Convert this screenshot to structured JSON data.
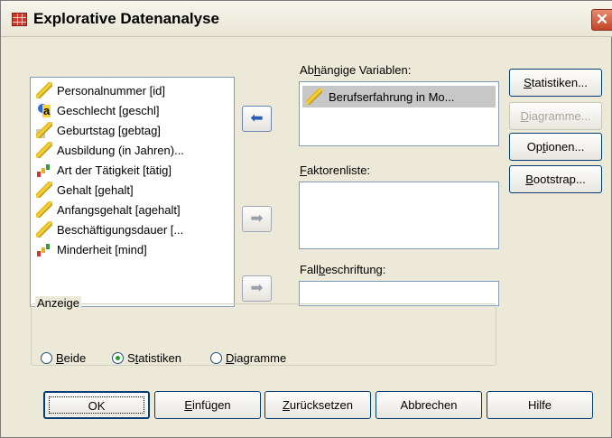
{
  "window": {
    "title": "Explorative Datenanalyse",
    "close_symbol": "✕"
  },
  "source_list": {
    "items": [
      {
        "label": "Personalnummer [id]",
        "icon": "scale-ruler-icon"
      },
      {
        "label": "Geschlecht [geschl]",
        "icon": "nominal-icon"
      },
      {
        "label": "Geburtstag [gebtag]",
        "icon": "date-icon"
      },
      {
        "label": "Ausbildung (in Jahren)...",
        "icon": "scale-ruler-icon"
      },
      {
        "label": "Art der Tätigkeit [tätig]",
        "icon": "ordinal-icon"
      },
      {
        "label": "Gehalt [gehalt]",
        "icon": "scale-ruler-icon"
      },
      {
        "label": "Anfangsgehalt [agehalt]",
        "icon": "scale-ruler-icon"
      },
      {
        "label": "Beschäftigungsdauer [...",
        "icon": "scale-ruler-icon"
      },
      {
        "label": "Minderheit [mind]",
        "icon": "ordinal-icon"
      }
    ]
  },
  "dependent": {
    "label_pre": "Ab",
    "label_u": "h",
    "label_post": "ängige Variablen:",
    "items": [
      {
        "label": "Berufserfahrung in Mo...",
        "icon": "scale-ruler-icon"
      }
    ]
  },
  "factors": {
    "label_u": "F",
    "label_post": "aktorenliste:"
  },
  "case_label": {
    "label_pre": "Fall",
    "label_u": "b",
    "label_post": "eschriftung:"
  },
  "side_buttons": {
    "statistics": {
      "pre": "",
      "u": "S",
      "post": "tatistiken..."
    },
    "plots": {
      "pre": "",
      "u": "D",
      "post": "iagramme..."
    },
    "options": {
      "pre": "Op",
      "u": "t",
      "post": "ionen..."
    },
    "bootstrap": {
      "pre": "",
      "u": "B",
      "post": "ootstrap..."
    }
  },
  "display": {
    "legend": "Anzeige",
    "options": [
      {
        "pre": "",
        "u": "B",
        "post": "eide",
        "selected": false
      },
      {
        "pre": "S",
        "u": "t",
        "post": "atistiken",
        "selected": true
      },
      {
        "pre": "",
        "u": "D",
        "post": "iagramme",
        "selected": false
      }
    ]
  },
  "bottom_buttons": {
    "ok": "OK",
    "paste": {
      "pre": "",
      "u": "E",
      "post": "infügen"
    },
    "reset": {
      "pre": "",
      "u": "Z",
      "post": "urücksetzen"
    },
    "cancel": "Abbrechen",
    "help": "Hilfe"
  },
  "arrows": {
    "move_symbol": "➡",
    "back_symbol": "⬅"
  }
}
